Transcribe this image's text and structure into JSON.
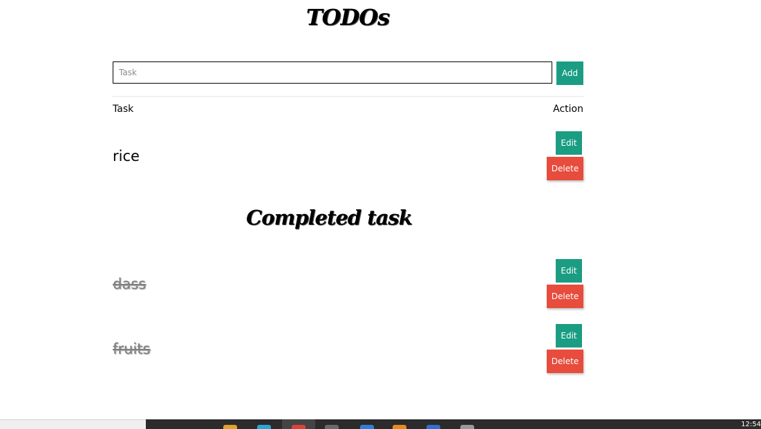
{
  "app": {
    "title": "TODOs"
  },
  "input": {
    "placeholder": "Task",
    "value": "",
    "add_label": "Add"
  },
  "table": {
    "col_task": "Task",
    "col_action": "Action"
  },
  "pending": [
    {
      "text": "rice",
      "edit_label": "Edit",
      "delete_label": "Delete"
    }
  ],
  "completed_heading": "Completed task",
  "completed": [
    {
      "text": "dass",
      "edit_label": "Edit",
      "delete_label": "Delete"
    },
    {
      "text": "fruits",
      "edit_label": "Edit",
      "delete_label": "Delete"
    }
  ],
  "taskbar": {
    "clock": "12:54"
  },
  "colors": {
    "primary": "#1a9d82",
    "danger": "#e74c3c",
    "completed_text": "#7f7f7f"
  }
}
